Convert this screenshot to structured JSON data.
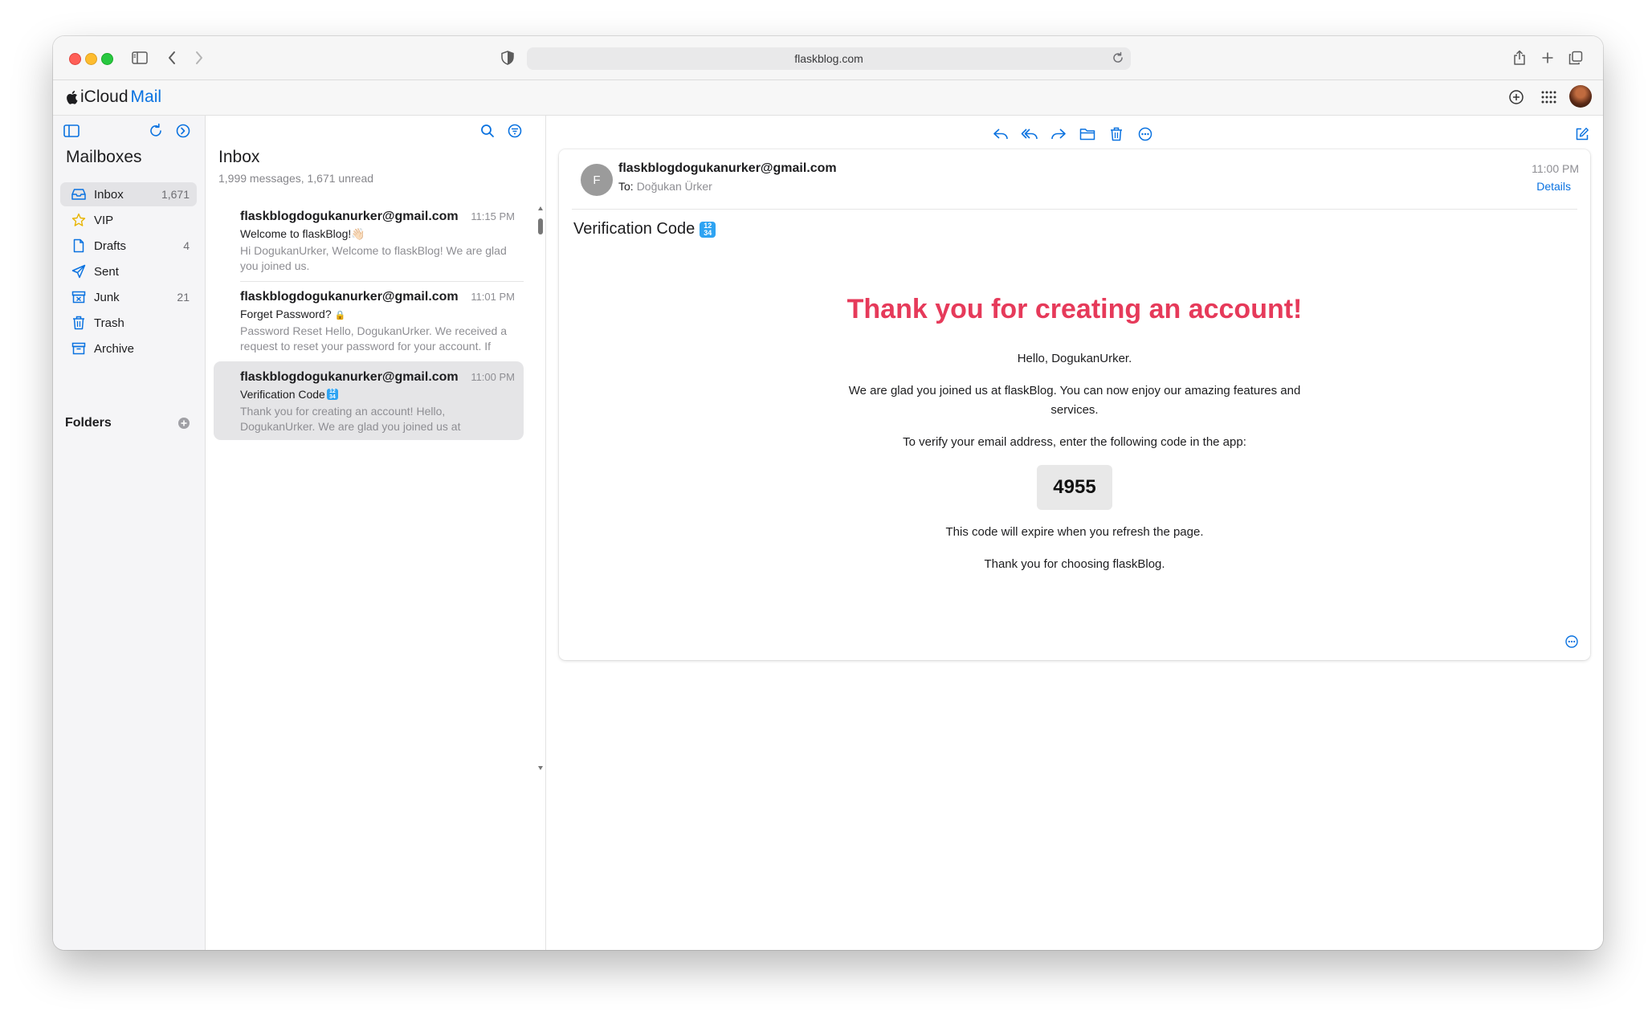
{
  "browser": {
    "url": "flaskblog.com"
  },
  "app": {
    "brand": "iCloud",
    "product": "Mail"
  },
  "sidebar": {
    "title": "Mailboxes",
    "items": [
      {
        "label": "Inbox",
        "count": "1,671",
        "icon": "inbox-icon"
      },
      {
        "label": "VIP",
        "count": "",
        "icon": "star-icon"
      },
      {
        "label": "Drafts",
        "count": "4",
        "icon": "document-icon"
      },
      {
        "label": "Sent",
        "count": "",
        "icon": "paper-plane-icon"
      },
      {
        "label": "Junk",
        "count": "21",
        "icon": "junk-icon"
      },
      {
        "label": "Trash",
        "count": "",
        "icon": "trash-icon"
      },
      {
        "label": "Archive",
        "count": "",
        "icon": "archive-icon"
      }
    ],
    "folders_label": "Folders"
  },
  "message_list": {
    "title": "Inbox",
    "subtitle": "1,999 messages, 1,671 unread",
    "messages": [
      {
        "from": "flaskblogdogukanurker@gmail.com",
        "time": "11:15 PM",
        "subject": "Welcome to flaskBlog!",
        "emoji": "👋🏻",
        "preview": "Hi DogukanUrker, Welcome to flaskBlog! We are glad you joined us."
      },
      {
        "from": "flaskblogdogukanurker@gmail.com",
        "time": "11:01 PM",
        "subject": "Forget Password?",
        "emoji": "🔒",
        "preview": "Password Reset Hello, DogukanUrker. We received a request to reset your password for your account. If"
      },
      {
        "from": "flaskblogdogukanurker@gmail.com",
        "time": "11:00 PM",
        "subject": "Verification Code",
        "emoji": "🔢",
        "preview": "Thank you for creating an account! Hello, DogukanUrker. We are glad you joined us at"
      }
    ]
  },
  "reader": {
    "sender_initial": "F",
    "sender_email": "flaskblogdogukanurker@gmail.com",
    "to_label": "To:",
    "to_name": "Doğukan Ürker",
    "time": "11:00 PM",
    "details_label": "Details",
    "subject": "Verification Code",
    "subject_emoji_text": "1234",
    "body": {
      "headline": "Thank you for creating an account!",
      "greeting": "Hello, DogukanUrker.",
      "intro": "We are glad you joined us at flaskBlog. You can now enjoy our amazing features and services.",
      "instruction": "To verify your email address, enter the following code in the app:",
      "code": "4955",
      "expiry": "This code will expire when you refresh the page.",
      "closing": "Thank you for choosing flaskBlog."
    }
  },
  "colors": {
    "accent": "#0a72e0",
    "headline": "#e63a5a",
    "selected_row": "#e5e5e7"
  }
}
